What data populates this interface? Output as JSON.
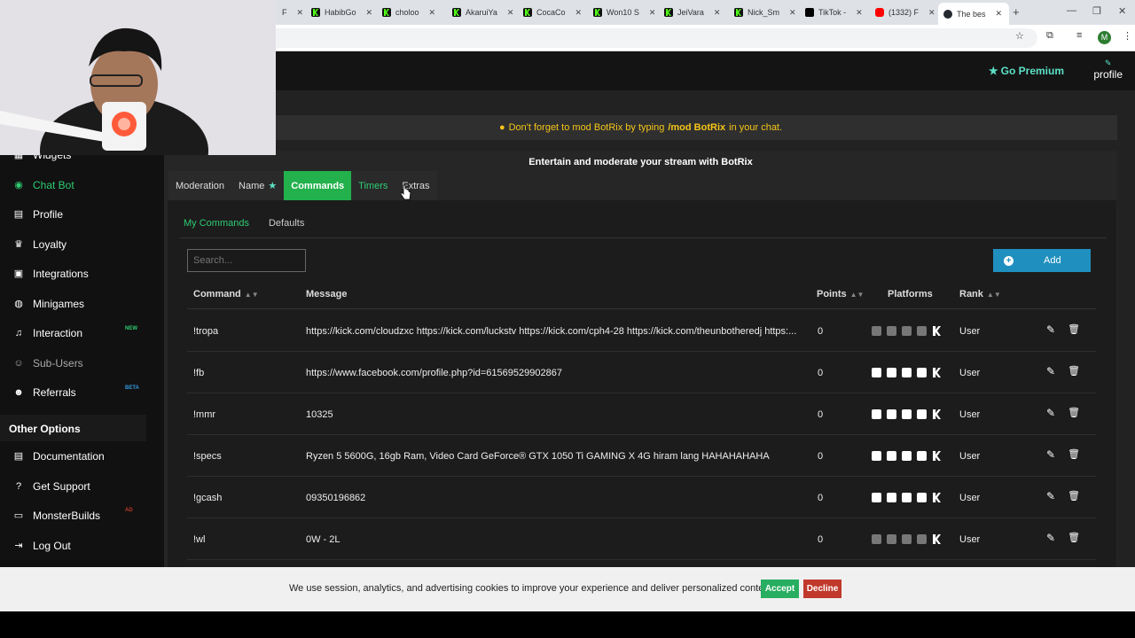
{
  "browser": {
    "tabs": [
      {
        "label": "F"
      },
      {
        "label": "HabibGo"
      },
      {
        "label": "choloo"
      },
      {
        "label": "AkaruiYa"
      },
      {
        "label": "CocaCo"
      },
      {
        "label": "Won10 S"
      },
      {
        "label": "JeiVara"
      },
      {
        "label": "Nick_Sm"
      },
      {
        "label": "TikTok -"
      },
      {
        "label": "(1332) F"
      },
      {
        "label": "The bes"
      }
    ],
    "new_tab": "+",
    "avatar_letter": "M"
  },
  "topbar": {
    "premium": "Go Premium",
    "profile": "profile"
  },
  "notice": {
    "prefix": "Don't forget to mod BotRix by typing",
    "command": "/mod BotRix",
    "suffix": "in your chat."
  },
  "sidebar": {
    "items": [
      {
        "label": "Widgets",
        "icon": "widgets-icon"
      },
      {
        "label": "Chat Bot",
        "icon": "robot-icon"
      },
      {
        "label": "Profile",
        "icon": "id-card-icon"
      },
      {
        "label": "Loyalty",
        "icon": "trophy-icon"
      },
      {
        "label": "Integrations",
        "icon": "integrations-icon"
      },
      {
        "label": "Minigames",
        "icon": "gamepad-icon"
      },
      {
        "label": "Interaction",
        "icon": "music-icon",
        "badge": "NEW"
      },
      {
        "label": "Sub-Users",
        "icon": "users-icon"
      },
      {
        "label": "Referrals",
        "icon": "referrals-icon",
        "badge": "BETA"
      }
    ],
    "other_options": "Other Options",
    "other_items": [
      {
        "label": "Documentation",
        "icon": "doc-icon"
      },
      {
        "label": "Get Support",
        "icon": "help-icon"
      },
      {
        "label": "MonsterBuilds",
        "icon": "monitor-icon",
        "badge": "AD"
      },
      {
        "label": "Log Out",
        "icon": "logout-icon"
      }
    ]
  },
  "panel": {
    "subtitle": "Entertain and moderate your stream with BotRix",
    "tabs": [
      "Moderation",
      "Name",
      "Commands",
      "Timers",
      "Extras"
    ],
    "subtabs": [
      "My Commands",
      "Defaults"
    ],
    "search_placeholder": "Search...",
    "add_label": "Add",
    "headers": {
      "command": "Command",
      "message": "Message",
      "points": "Points",
      "platforms": "Platforms",
      "rank": "Rank"
    },
    "rows": [
      {
        "command": "!tropa",
        "message": "https://kick.com/cloudzxc https://kick.com/luckstv https://kick.com/cph4-28 https://kick.com/theunbotheredj https:...",
        "points": "0",
        "rank": "User",
        "platforms_dim": true
      },
      {
        "command": "!fb",
        "message": "https://www.facebook.com/profile.php?id=61569529902867",
        "points": "0",
        "rank": "User",
        "platforms_dim": false
      },
      {
        "command": "!mmr",
        "message": "10325",
        "points": "0",
        "rank": "User",
        "platforms_dim": false
      },
      {
        "command": "!specs",
        "message": "Ryzen 5 5600G, 16gb Ram, Video Card GeForce® GTX 1050 Ti GAMING X 4G hiram lang HAHAHAHAHA",
        "points": "0",
        "rank": "User",
        "platforms_dim": false
      },
      {
        "command": "!gcash",
        "message": "09350196862",
        "points": "0",
        "rank": "User",
        "platforms_dim": false
      },
      {
        "command": "!wl",
        "message": "0W - 2L",
        "points": "0",
        "rank": "User",
        "platforms_dim": true
      }
    ]
  },
  "cookie": {
    "text": "We use session, analytics, and advertising cookies to improve your experience and deliver personalized content.",
    "accept": "Accept",
    "decline": "Decline"
  },
  "colors": {
    "accent": "#22b14c",
    "premium": "#5ce1c6",
    "add_button": "#1f8fbf",
    "notice": "#f5c518"
  }
}
